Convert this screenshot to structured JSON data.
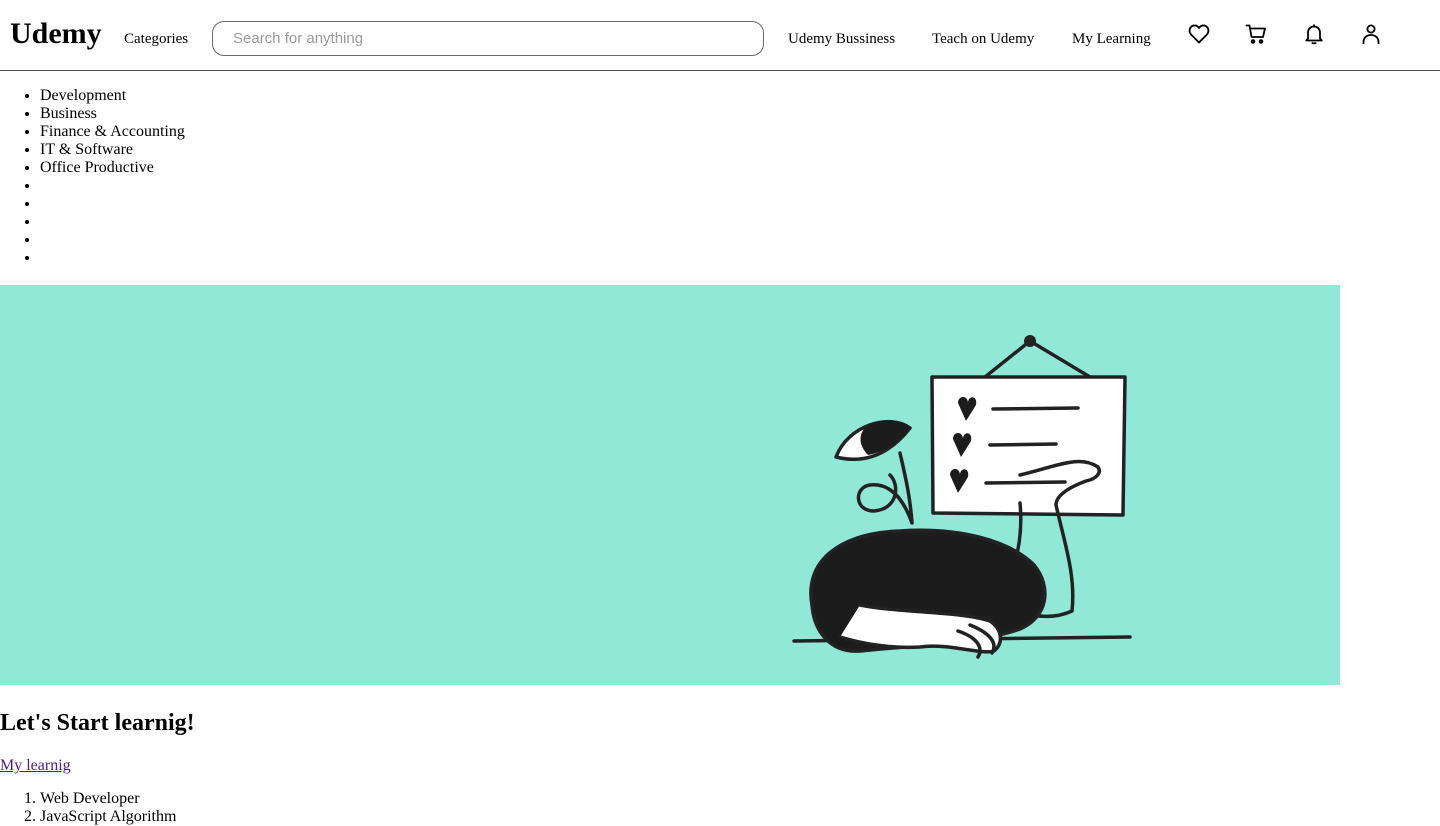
{
  "header": {
    "logo": "Udemy",
    "categories_label": "Categories",
    "search_placeholder": "Search for anything",
    "nav": {
      "business": "Udemy Bussiness",
      "teach": "Teach on Udemy",
      "my_learning": "My Learning"
    },
    "icons": [
      "heart-icon",
      "cart-icon",
      "bell-icon",
      "user-icon"
    ]
  },
  "categories_list": [
    "Development",
    "Business",
    "Finance & Accounting",
    "IT & Software",
    "Office Productive",
    "",
    "",
    "",
    "",
    ""
  ],
  "hero": {
    "background_color": "#92e8d6",
    "title": "Let's Start learnig!",
    "link": "My learnig"
  },
  "courses": [
    "Web Developer",
    "JavaScript Algorithm"
  ]
}
